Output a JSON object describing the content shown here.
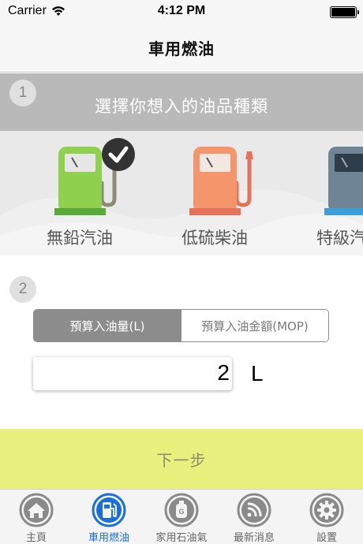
{
  "status_bar": {
    "carrier": "Carrier",
    "time": "4:12 PM"
  },
  "nav": {
    "title": "車用燃油"
  },
  "step1": {
    "number": "1",
    "title": "選擇你想入的油品種類",
    "fuels": [
      {
        "label": "無鉛汽油",
        "color": "#8fd14f",
        "base": "#5ba83a",
        "selected": true
      },
      {
        "label": "低硫柴油",
        "color": "#f5956c",
        "base": "#e5735a",
        "selected": false
      },
      {
        "label": "特級汽油",
        "color": "#6f8494",
        "base": "#3e9ed8",
        "selected": false
      }
    ]
  },
  "step2": {
    "number": "2",
    "segments": [
      {
        "label": "預算入油量(L)",
        "active": true
      },
      {
        "label": "預算入油金額(MOP)",
        "active": false
      }
    ],
    "amount_value": "2",
    "unit": "L"
  },
  "next_button": {
    "label": "下一步"
  },
  "tabs": [
    {
      "label": "主頁",
      "icon": "home-icon",
      "active": false
    },
    {
      "label": "車用燃油",
      "icon": "fuel-pump-icon",
      "active": true
    },
    {
      "label": "家用石油氣",
      "icon": "gas-cylinder-icon",
      "active": false
    },
    {
      "label": "最新消息",
      "icon": "rss-icon",
      "active": false
    },
    {
      "label": "設置",
      "icon": "gear-icon",
      "active": false
    }
  ],
  "colors": {
    "step_header": "#b9b9b9",
    "next_button": "#eaf07e",
    "tab_active": "#1a6fd8",
    "segment_active": "#8d8d8d"
  }
}
